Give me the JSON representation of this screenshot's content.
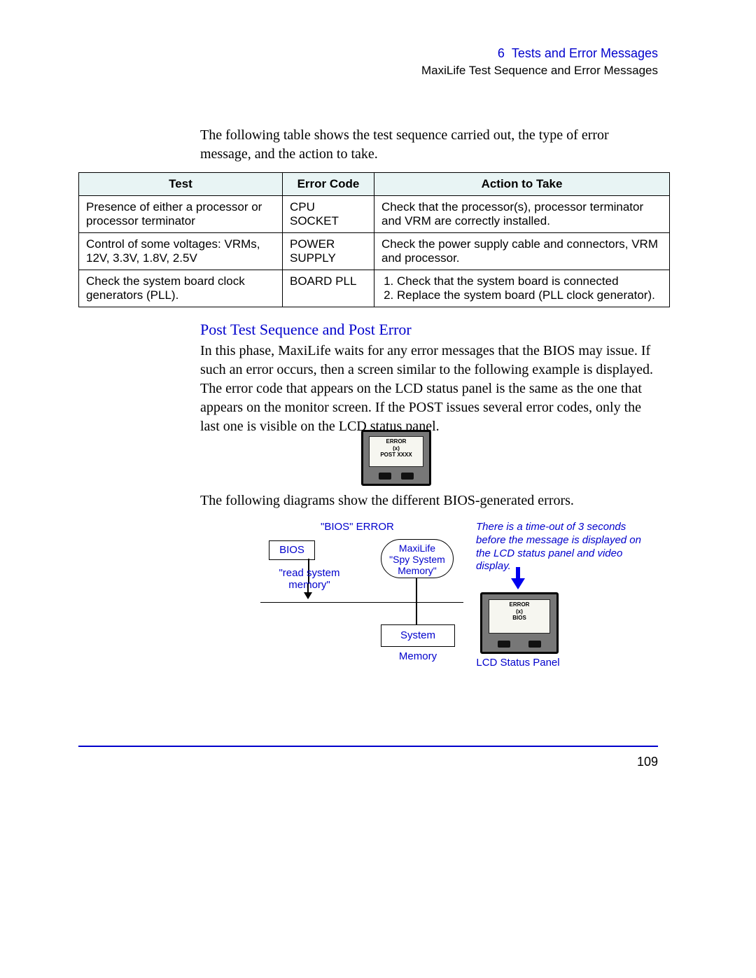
{
  "header": {
    "chapter_num": "6",
    "chapter_title": "Tests and Error Messages",
    "section": "MaxiLife Test Sequence and Error Messages"
  },
  "intro": "The following table shows the test sequence carried out, the type of error message, and the action to take.",
  "table": {
    "headers": [
      "Test",
      "Error Code",
      "Action to Take"
    ],
    "rows": [
      {
        "test": "Presence of either a processor or processor terminator",
        "code": "CPU SOCKET",
        "action": "Check that the processor(s), processor terminator and VRM are correctly installed."
      },
      {
        "test": "Control of some voltages: VRMs, 12V, 3.3V, 1.8V, 2.5V",
        "code": "POWER SUPPLY",
        "action": "Check the power supply cable and connectors, VRM and processor."
      },
      {
        "test": "Check the system board clock generators (PLL).",
        "code": "BOARD PLL",
        "action_list": [
          "Check that the system board is connected",
          "Replace the system board (PLL clock generator)."
        ]
      }
    ]
  },
  "section_title": "Post Test Sequence and Post Error",
  "section_body": "In this phase, MaxiLife waits for any error messages that the BIOS may issue. If such an error occurs, then a screen similar to the following example is displayed. The error code that appears on the LCD status panel is the same as the one that appears on the monitor screen. If the POST issues several error codes, only the last one is visible on the LCD status panel.",
  "lcd1": {
    "line1": "ERROR",
    "line2": "(x)",
    "line3": "POST XXXX"
  },
  "diagrams_intro": "The following diagrams show the different BIOS-generated errors.",
  "diagram": {
    "title": "\"BIOS\" ERROR",
    "bios": "BIOS",
    "read_mem": "\"read system memory\"",
    "maxilife_l1": "MaxiLife",
    "maxilife_l2": "\"Spy System",
    "maxilife_l3": "Memory\"",
    "sys_mem": "System Memory"
  },
  "note": "There is a time-out of 3 seconds before the message is displayed on the LCD status panel and video display.",
  "lcd2": {
    "line1": "ERROR",
    "line2": "(x)",
    "line3": "BIOS"
  },
  "lcd_label": "LCD Status Panel",
  "page_number": "109"
}
